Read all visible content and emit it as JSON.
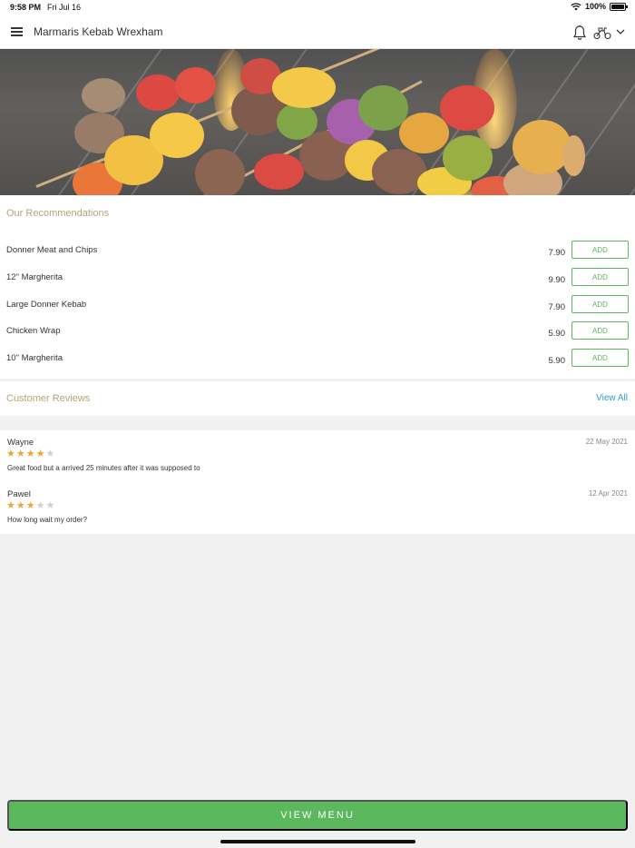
{
  "status_bar": {
    "time": "9:58 PM",
    "date": "Fri Jul 16",
    "battery": "100%",
    "icons": [
      "wifi-icon",
      "battery-icon"
    ]
  },
  "app_bar": {
    "title": "Marmaris Kebab Wrexham",
    "icons": [
      "menu-icon",
      "bell-icon",
      "scooter-icon",
      "chevron-down-icon"
    ]
  },
  "recommendations": {
    "title": "Our Recommendations",
    "items": [
      {
        "name": "Donner Meat and Chips",
        "price": "7.90",
        "button": "ADD"
      },
      {
        "name": "12\" Margherita",
        "price": "9.90",
        "button": "ADD"
      },
      {
        "name": "Large Donner Kebab",
        "price": "7.90",
        "button": "ADD"
      },
      {
        "name": "Chicken Wrap",
        "price": "5.90",
        "button": "ADD"
      },
      {
        "name": "10\" Margherita",
        "price": "5.90",
        "button": "ADD"
      }
    ]
  },
  "reviews": {
    "title": "Customer Reviews",
    "view_all": "View All",
    "items": [
      {
        "author": "Wayne",
        "date": "22 May 2021",
        "rating": 4,
        "max_rating": 5,
        "text": "Great food but a arrived 25 minutes after it was supposed to"
      },
      {
        "author": "Pawel",
        "date": "12 Apr 2021",
        "rating": 3,
        "max_rating": 5,
        "text": "How long wait my order?"
      }
    ]
  },
  "footer": {
    "view_menu": "VIEW MENU"
  },
  "colors": {
    "accent_green": "#5cb85c",
    "section_title": "#b8a27a",
    "link_blue": "#2aa0c8",
    "star_on": "#f0a531",
    "star_off": "#cfcfcf"
  }
}
